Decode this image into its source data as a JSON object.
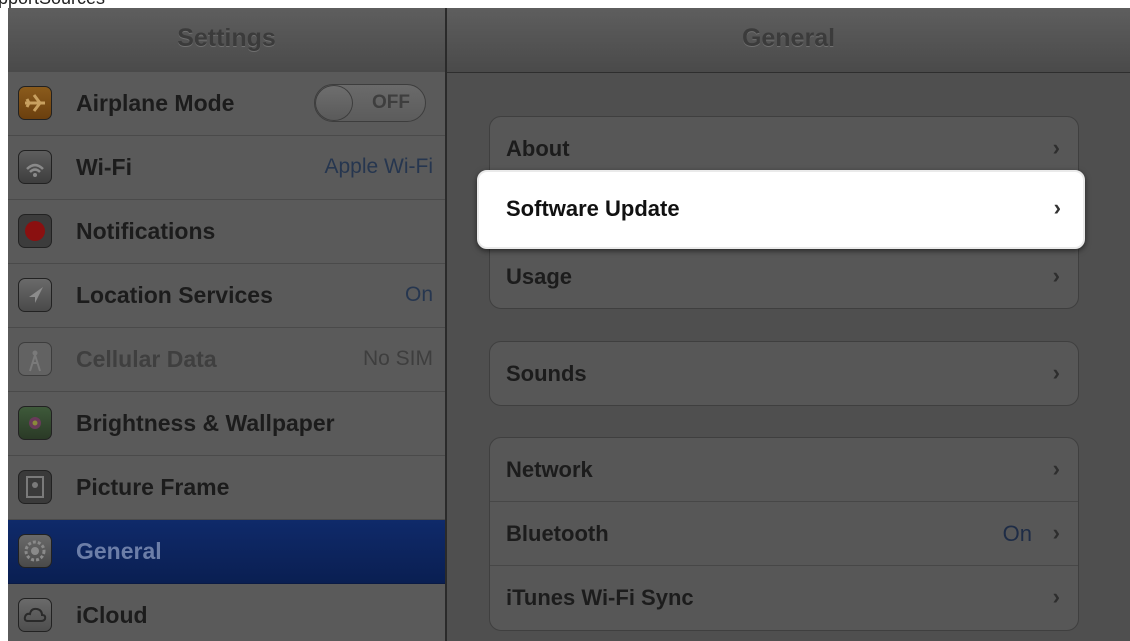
{
  "top_fragment": "pportSources",
  "master": {
    "title": "Settings",
    "items": [
      {
        "label": "Airplane Mode",
        "toggle": "OFF",
        "icon": "airplane-icon"
      },
      {
        "label": "Wi-Fi",
        "value": "Apple Wi-Fi",
        "icon": "wifi-icon"
      },
      {
        "label": "Notifications",
        "icon": "notifications-icon"
      },
      {
        "label": "Location Services",
        "value": "On",
        "icon": "location-arrow-icon"
      },
      {
        "label": "Cellular Data",
        "value": "No SIM",
        "icon": "antenna-icon"
      },
      {
        "label": "Brightness & Wallpaper",
        "icon": "flower-icon"
      },
      {
        "label": "Picture Frame",
        "icon": "picture-frame-icon"
      },
      {
        "label": "General",
        "icon": "gear-icon"
      },
      {
        "label": "iCloud",
        "icon": "cloud-icon"
      }
    ]
  },
  "detail": {
    "title": "General",
    "group1": [
      {
        "label": "About"
      },
      {
        "label": "Software Update"
      },
      {
        "label": "Usage"
      }
    ],
    "group2": [
      {
        "label": "Sounds"
      }
    ],
    "group3": [
      {
        "label": "Network"
      },
      {
        "label": "Bluetooth",
        "value": "On"
      },
      {
        "label": "iTunes Wi-Fi Sync"
      }
    ]
  },
  "colors": {
    "selected_row": "#0f2a6a",
    "highlight": "#ffffff",
    "overlay_dim": "#505050"
  }
}
